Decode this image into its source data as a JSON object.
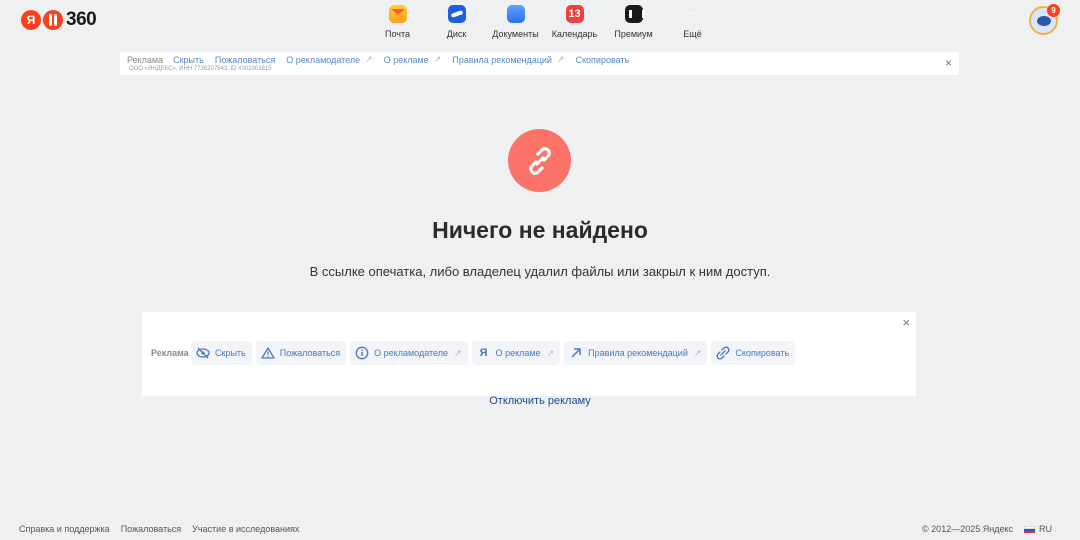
{
  "header": {
    "logo_letter": "Я",
    "logo_number": "360",
    "services": [
      {
        "label": "Почта",
        "icon": "mail-icon"
      },
      {
        "label": "Диск",
        "icon": "disk-icon"
      },
      {
        "label": "Документы",
        "icon": "docs-icon"
      },
      {
        "label": "Календарь",
        "icon": "calendar-icon",
        "badge": "13"
      },
      {
        "label": "Премиум",
        "icon": "premium-icon"
      },
      {
        "label": "Ещё",
        "icon": "more-icon",
        "glyph": "···"
      }
    ],
    "avatar_badge": "9"
  },
  "top_ad": {
    "label": "Реклама",
    "links": [
      "Скрыть",
      "Пожаловаться",
      "О рекламодателе",
      "О рекламе",
      "Правила рекомендаций",
      "Скопировать"
    ],
    "sub": "ООО «ЯНДЕКС», ИНН 7736207543, ID #302301815",
    "close": "×"
  },
  "main": {
    "title": "Ничего не найдено",
    "description": "В ссылке опечатка, либо владелец удалил файлы или закрыл к ним доступ."
  },
  "bottom_ad": {
    "label": "Реклама",
    "chips": [
      "Скрыть",
      "Пожаловаться",
      "О рекламодателе",
      "О рекламе",
      "Правила рекомендаций",
      "Скопировать"
    ],
    "close": "×",
    "disable": "Отключить рекламу"
  },
  "footer": {
    "links": [
      "Справка и поддержка",
      "Пожаловаться",
      "Участие в исследованиях"
    ],
    "copyright": "© 2012—2025 Яндекс",
    "lang": "RU"
  },
  "colors": {
    "background": "#eff0f2",
    "accent_red": "#fc3f1d",
    "error_circle": "#fa7268",
    "link": "#5a87c6"
  }
}
